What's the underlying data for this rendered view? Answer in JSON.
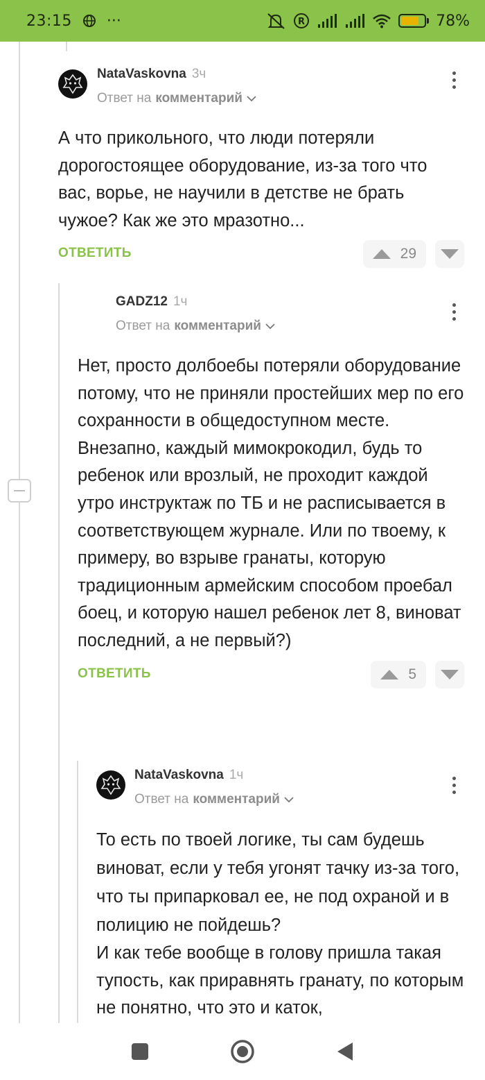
{
  "status_bar": {
    "time": "23:15",
    "more": "···",
    "battery_level": 0.78,
    "battery_label": "78%",
    "colors": {
      "bar": "#8ac24a",
      "battery_fill": "#e8b400"
    }
  },
  "comments": [
    {
      "author": "NataVaskovna",
      "time": "3ч",
      "reply_prefix": "Ответ на",
      "reply_target": "комментарий",
      "body": "А что прикольного, что люди потеряли дорогостоящее оборудование, из-за того что вас, ворье, не научили в детстве не брать чужое? Как же это мразотно...",
      "reply_label": "ОТВЕТИТЬ",
      "rating": "29",
      "has_avatar": true
    },
    {
      "author": "GADZ12",
      "time": "1ч",
      "reply_prefix": "Ответ на",
      "reply_target": "комментарий",
      "body": "Нет, просто долбоебы потеряли оборудование потому, что не приняли простейших мер по его сохранности в общедоступном месте. Внезапно, каждый мимокрокодил, будь то ребенок или врозлый, не проходит каждой утро инструктаж по ТБ и не расписывается в соответствующем журнале. Или по твоему, к примеру, во взрыве гранаты, которую традиционным армейским способом проебал боец, и которую нашел ребенок лет 8, виноват последний, а не первый?)",
      "reply_label": "ОТВЕТИТЬ",
      "rating": "5",
      "has_avatar": false
    },
    {
      "author": "NataVaskovna",
      "time": "1ч",
      "reply_prefix": "Ответ на",
      "reply_target": "комментарий",
      "body_lines": [
        "То есть по твоей логике, ты сам будешь виноват, если у тебя угонят тачку из-за того, что ты припарковал ее, не под охраной и в полицию не пойдешь?",
        "И как тебе вообще в голову пришла такая тупость, как приравнять гранату, по которым не понятно, что это и каток,"
      ],
      "has_avatar": true
    }
  ],
  "accent_color": "#8ac24a"
}
